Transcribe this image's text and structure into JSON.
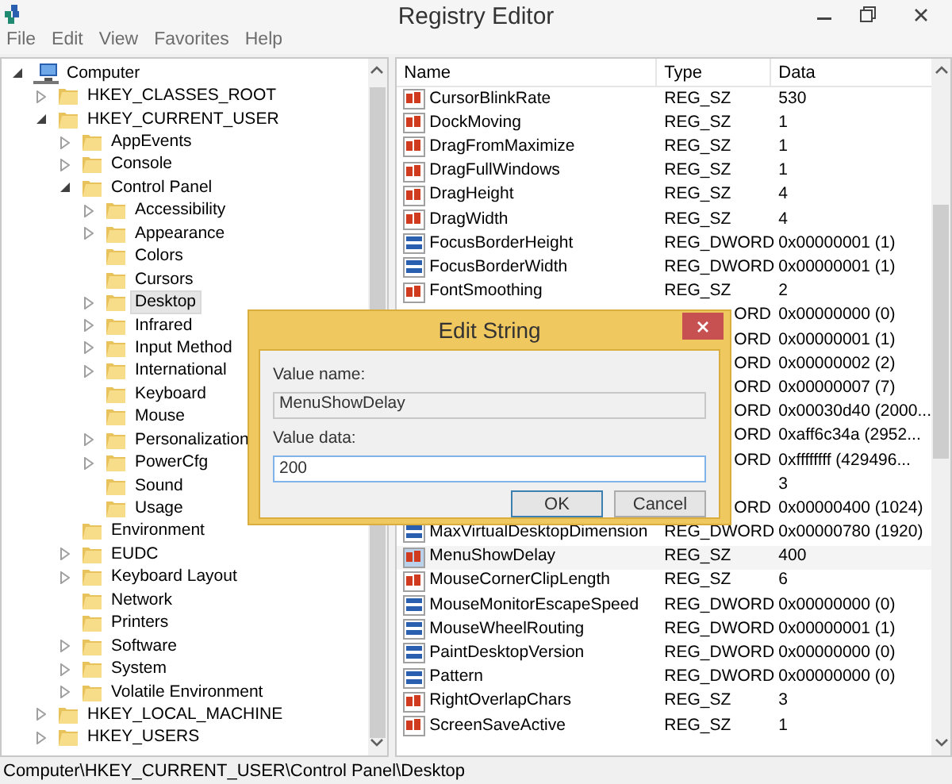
{
  "window": {
    "title": "Registry Editor"
  },
  "menu": [
    "File",
    "Edit",
    "View",
    "Favorites",
    "Help"
  ],
  "tree": {
    "label": "Computer",
    "kind": "computer",
    "expanded": true,
    "selected": false,
    "children": [
      {
        "label": "HKEY_CLASSES_ROOT",
        "kind": "folder",
        "expanded": false,
        "selected": false
      },
      {
        "label": "HKEY_CURRENT_USER",
        "kind": "folder",
        "expanded": true,
        "selected": false,
        "children": [
          {
            "label": "AppEvents",
            "kind": "folder",
            "expanded": false,
            "selected": false
          },
          {
            "label": "Console",
            "kind": "folder",
            "expanded": false,
            "selected": false
          },
          {
            "label": "Control Panel",
            "kind": "folder",
            "expanded": true,
            "selected": false,
            "children": [
              {
                "label": "Accessibility",
                "kind": "folder",
                "expanded": false,
                "selected": false
              },
              {
                "label": "Appearance",
                "kind": "folder",
                "expanded": false,
                "selected": false
              },
              {
                "label": "Colors",
                "kind": "folder",
                "selected": false
              },
              {
                "label": "Cursors",
                "kind": "folder",
                "selected": false
              },
              {
                "label": "Desktop",
                "kind": "folder",
                "expanded": false,
                "selected": true
              },
              {
                "label": "Infrared",
                "kind": "folder",
                "expanded": false,
                "selected": false
              },
              {
                "label": "Input Method",
                "kind": "folder",
                "expanded": false,
                "selected": false
              },
              {
                "label": "International",
                "kind": "folder",
                "expanded": false,
                "selected": false
              },
              {
                "label": "Keyboard",
                "kind": "folder",
                "selected": false
              },
              {
                "label": "Mouse",
                "kind": "folder",
                "selected": false
              },
              {
                "label": "Personalization",
                "kind": "folder",
                "expanded": false,
                "selected": false
              },
              {
                "label": "PowerCfg",
                "kind": "folder",
                "expanded": false,
                "selected": false
              },
              {
                "label": "Sound",
                "kind": "folder",
                "selected": false
              },
              {
                "label": "Usage",
                "kind": "folder",
                "selected": false
              }
            ]
          },
          {
            "label": "Environment",
            "kind": "folder",
            "selected": false
          },
          {
            "label": "EUDC",
            "kind": "folder",
            "expanded": false,
            "selected": false
          },
          {
            "label": "Keyboard Layout",
            "kind": "folder",
            "expanded": false,
            "selected": false
          },
          {
            "label": "Network",
            "kind": "folder",
            "selected": false
          },
          {
            "label": "Printers",
            "kind": "folder",
            "selected": false
          },
          {
            "label": "Software",
            "kind": "folder",
            "expanded": false,
            "selected": false
          },
          {
            "label": "System",
            "kind": "folder",
            "expanded": false,
            "selected": false
          },
          {
            "label": "Volatile Environment",
            "kind": "folder",
            "expanded": false,
            "selected": false
          }
        ]
      },
      {
        "label": "HKEY_LOCAL_MACHINE",
        "kind": "folder",
        "expanded": false,
        "selected": false
      },
      {
        "label": "HKEY_USERS",
        "kind": "folder",
        "expanded": false,
        "selected": false
      }
    ]
  },
  "values": {
    "columns": [
      "Name",
      "Type",
      "Data"
    ],
    "rows": [
      {
        "kind": "sz",
        "name": "CursorBlinkRate",
        "type": "REG_SZ",
        "data": "530",
        "selected": false
      },
      {
        "kind": "sz",
        "name": "DockMoving",
        "type": "REG_SZ",
        "data": "1",
        "selected": false
      },
      {
        "kind": "sz",
        "name": "DragFromMaximize",
        "type": "REG_SZ",
        "data": "1",
        "selected": false
      },
      {
        "kind": "sz",
        "name": "DragFullWindows",
        "type": "REG_SZ",
        "data": "1",
        "selected": false
      },
      {
        "kind": "sz",
        "name": "DragHeight",
        "type": "REG_SZ",
        "data": "4",
        "selected": false
      },
      {
        "kind": "sz",
        "name": "DragWidth",
        "type": "REG_SZ",
        "data": "4",
        "selected": false
      },
      {
        "kind": "dword",
        "name": "FocusBorderHeight",
        "type": "REG_DWORD",
        "data": "0x00000001 (1)",
        "selected": false
      },
      {
        "kind": "dword",
        "name": "FocusBorderWidth",
        "type": "REG_DWORD",
        "data": "0x00000001 (1)",
        "selected": false
      },
      {
        "kind": "sz",
        "name": "FontSmoothing",
        "type": "REG_SZ",
        "data": "2",
        "selected": false
      },
      {
        "kind": "covered",
        "type": "ORD",
        "data": "0x00000000 (0)"
      },
      {
        "kind": "covered",
        "type": "ORD",
        "data": "0x00000001 (1)"
      },
      {
        "kind": "covered",
        "type": "ORD",
        "data": "0x00000002 (2)"
      },
      {
        "kind": "covered",
        "type": "ORD",
        "data": "0x00000007 (7)"
      },
      {
        "kind": "covered",
        "type": "ORD",
        "data": "0x00030d40 (2000..."
      },
      {
        "kind": "covered",
        "type": "ORD",
        "data": "0xaff6c34a (2952..."
      },
      {
        "kind": "covered",
        "type": "ORD",
        "data": "0xffffffff (429496..."
      },
      {
        "kind": "covered",
        "data": "3"
      },
      {
        "kind": "covered",
        "type": "ORD",
        "data": "0x00000400 (1024)"
      },
      {
        "kind": "dword",
        "name": "MaxVirtualDesktopDimension",
        "type": "REG_DWORD",
        "data": "0x00000780 (1920)",
        "selected": false
      },
      {
        "kind": "sz",
        "name": "MenuShowDelay",
        "type": "REG_SZ",
        "data": "400",
        "selected": true
      },
      {
        "kind": "sz",
        "name": "MouseCornerClipLength",
        "type": "REG_SZ",
        "data": "6",
        "selected": false
      },
      {
        "kind": "dword",
        "name": "MouseMonitorEscapeSpeed",
        "type": "REG_DWORD",
        "data": "0x00000000 (0)",
        "selected": false
      },
      {
        "kind": "dword",
        "name": "MouseWheelRouting",
        "type": "REG_DWORD",
        "data": "0x00000001 (1)",
        "selected": false
      },
      {
        "kind": "dword",
        "name": "PaintDesktopVersion",
        "type": "REG_DWORD",
        "data": "0x00000000 (0)",
        "selected": false
      },
      {
        "kind": "dword",
        "name": "Pattern",
        "type": "REG_DWORD",
        "data": "0x00000000 (0)",
        "selected": false
      },
      {
        "kind": "sz",
        "name": "RightOverlapChars",
        "type": "REG_SZ",
        "data": "3",
        "selected": false
      },
      {
        "kind": "sz",
        "name": "ScreenSaveActive",
        "type": "REG_SZ",
        "data": "1",
        "selected": false
      }
    ]
  },
  "dialog": {
    "title": "Edit String",
    "name_label": "Value name:",
    "name_value": "MenuShowDelay",
    "data_label": "Value data:",
    "data_value": "200",
    "buttons": [
      {
        "label": "OK",
        "default": true
      },
      {
        "label": "Cancel",
        "default": false
      }
    ]
  },
  "status_bar": "Computer\\HKEY_CURRENT_USER\\Control Panel\\Desktop"
}
